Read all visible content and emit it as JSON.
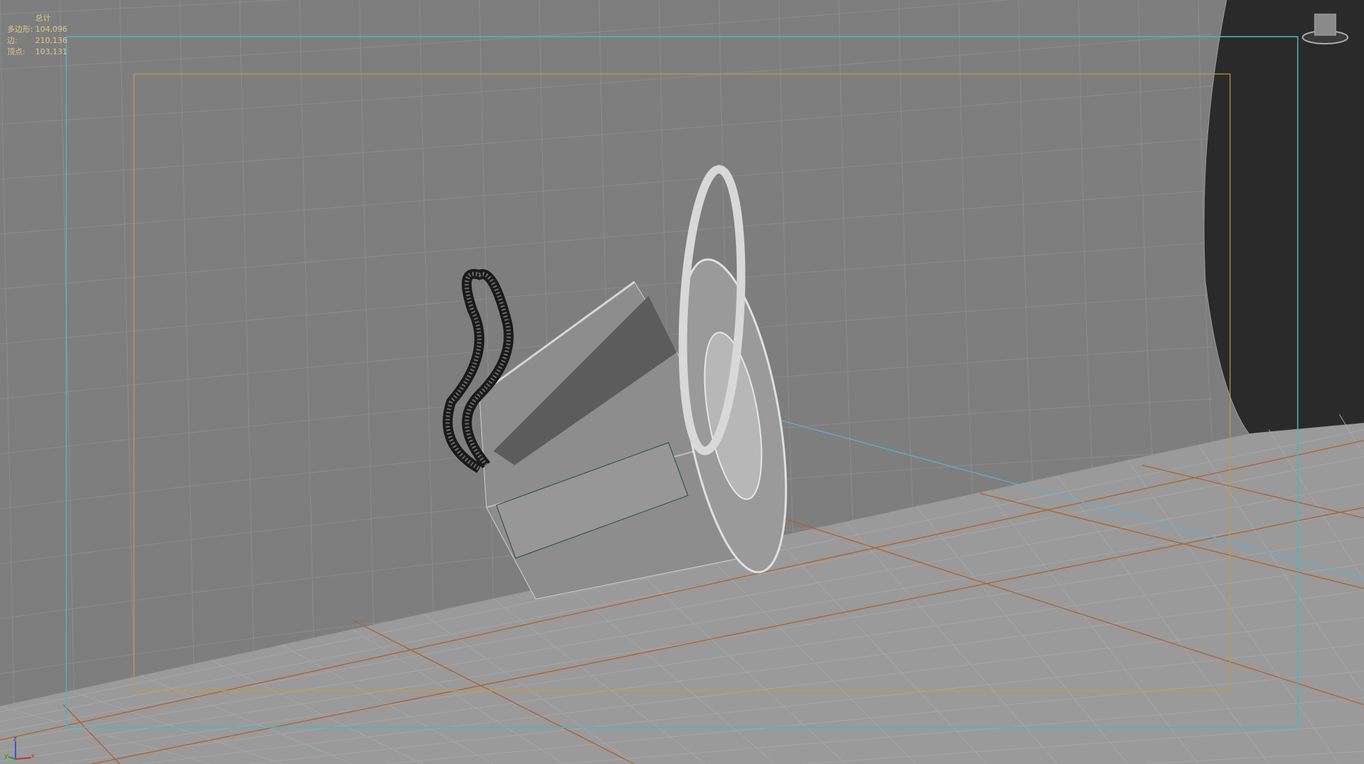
{
  "stats": {
    "header": "总计",
    "rows": [
      {
        "label": "多边形:",
        "value": "104,096"
      },
      {
        "label": "边:",
        "value": "210,136"
      },
      {
        "label": "顶点:",
        "value": "103,131"
      }
    ]
  },
  "axis_labels": {
    "x": "x",
    "y": "y",
    "z": "z"
  },
  "colors": {
    "safe_frame": "#4fb3c0",
    "render_frame": "#c89a3a",
    "floor_grid": "#b0602a",
    "background": "#7e7e7e"
  }
}
